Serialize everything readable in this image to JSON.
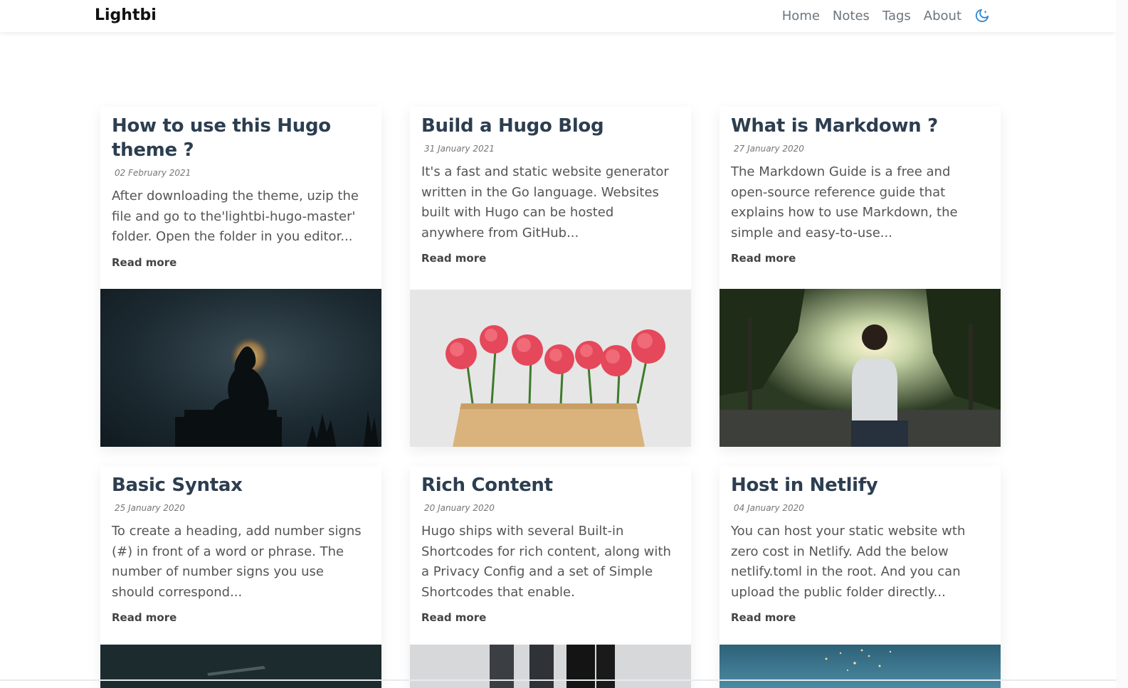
{
  "site": {
    "brand": "Lightbi",
    "nav": [
      "Home",
      "Notes",
      "Tags",
      "About"
    ],
    "theme_toggle_icon": "moon-icon",
    "accent": "#2f86d9"
  },
  "posts": [
    {
      "title": "How to use this Hugo theme ?",
      "date": "02 February 2021",
      "summary": "After downloading the theme, uzip the file and go to the'lightbi-hugo-master' folder. Open the folder in you editor...",
      "read_more": "Read more",
      "image": "buddha-silhouette-image"
    },
    {
      "title": "Build a Hugo Blog",
      "date": "31 January 2021",
      "summary": "It's a fast and static website generator written in the Go language. Websites built with Hugo can be hosted anywhere from GitHub...",
      "read_more": "Read more",
      "image": "pink-carnations-image"
    },
    {
      "title": "What is Markdown ?",
      "date": "27 January 2020",
      "summary": "The Markdown Guide is a free and open-source reference guide that explains how to use Markdown, the simple and easy-to-use...",
      "read_more": "Read more",
      "image": "man-in-park-image"
    },
    {
      "title": "Basic Syntax",
      "date": "25 January 2020",
      "summary": "To create a heading, add number signs (#) in front of a word or phrase. The number of number signs you use should correspond...",
      "read_more": "Read more",
      "image": "dark-scene-image"
    },
    {
      "title": "Rich Content",
      "date": "20 January 2020",
      "summary": "Hugo ships with several Built-in Shortcodes for rich content, along with a Privacy Config and a set of Simple Shortcodes that enable.",
      "read_more": "Read more",
      "image": "people-standing-image"
    },
    {
      "title": "Host in Netlify",
      "date": "04 January 2020",
      "summary": "You can host your static website wth zero cost in Netlify. Add the below netlify.toml in the root. And you can upload the public folder directly...",
      "read_more": "Read more",
      "image": "blue-sparkle-image"
    }
  ]
}
